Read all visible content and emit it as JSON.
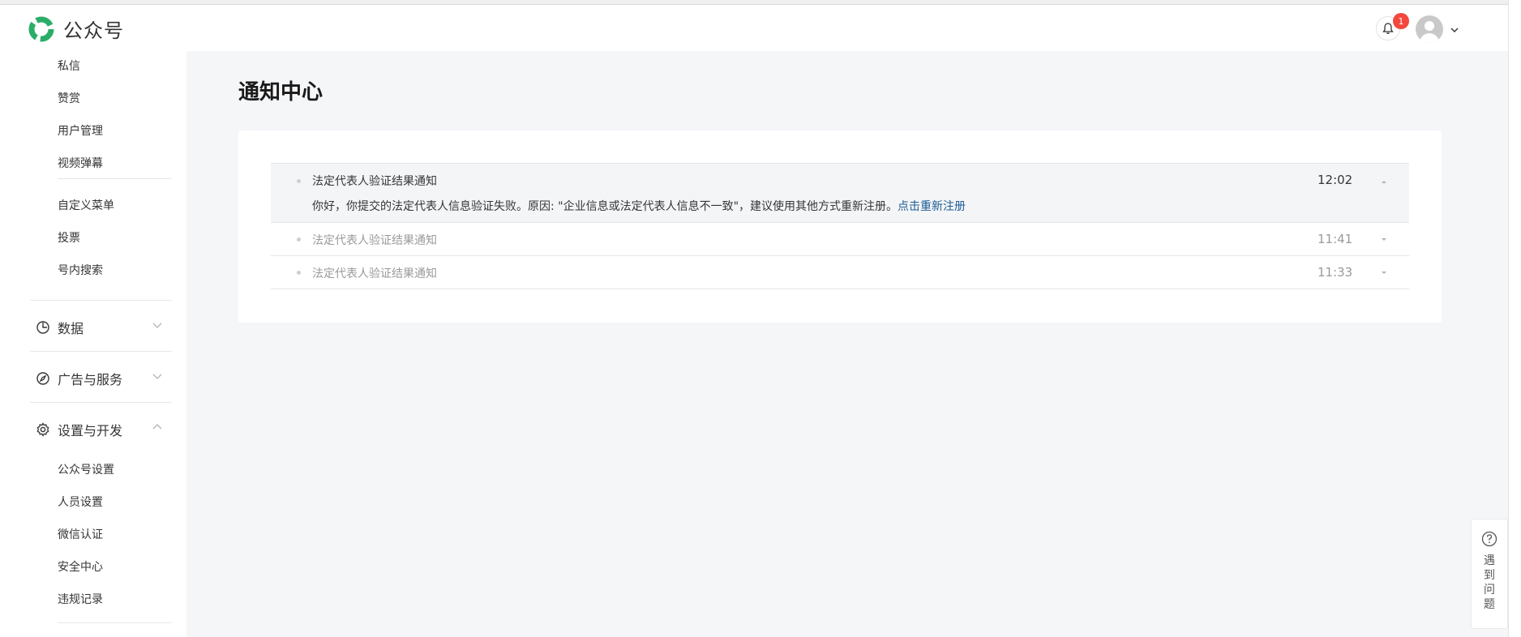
{
  "header": {
    "logo_text": "公众号",
    "notification_count": "1"
  },
  "sidebar": {
    "items_top": [
      "私信",
      "赞赏",
      "用户管理",
      "视频弹幕"
    ],
    "items_mid": [
      "自定义菜单",
      "投票",
      "号内搜索"
    ],
    "sections": [
      {
        "label": "数据",
        "icon": "pie-chart-icon",
        "expanded": false
      },
      {
        "label": "广告与服务",
        "icon": "compass-icon",
        "expanded": false
      },
      {
        "label": "设置与开发",
        "icon": "gear-icon",
        "expanded": true
      }
    ],
    "items_settings": [
      "公众号设置",
      "人员设置",
      "微信认证",
      "安全中心",
      "违规记录"
    ]
  },
  "main": {
    "title": "通知中心",
    "notifications": [
      {
        "title": "法定代表人验证结果通知",
        "time": "12:02",
        "expanded": true,
        "body": "你好，你提交的法定代表人信息验证失败。原因: \"企业信息或法定代表人信息不一致\"，建议使用其他方式重新注册。",
        "link": "点击重新注册"
      },
      {
        "title": "法定代表人验证结果通知",
        "time": "11:41",
        "expanded": false
      },
      {
        "title": "法定代表人验证结果通知",
        "time": "11:33",
        "expanded": false
      }
    ]
  },
  "help": {
    "label": "遇到问题"
  },
  "colors": {
    "brand_green": "#2aae67",
    "link_blue": "#1d5c96",
    "badge_red": "#f4473d"
  }
}
